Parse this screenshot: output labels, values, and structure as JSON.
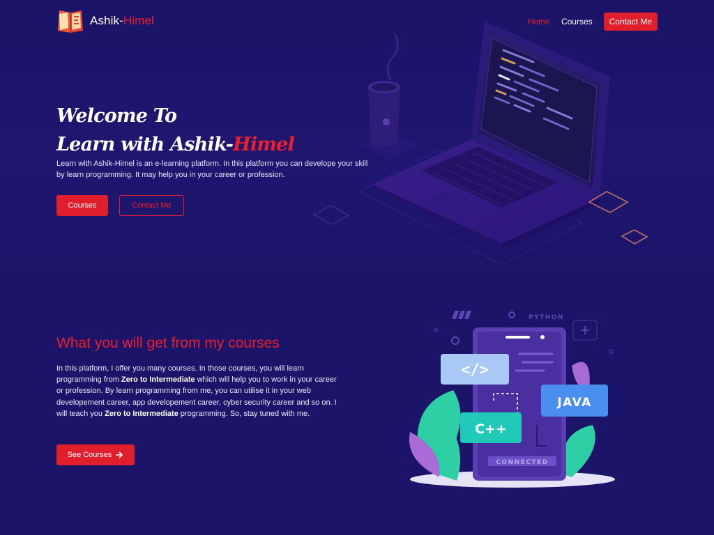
{
  "brand": {
    "name_part1": "Ashik-",
    "name_part2": "Himel"
  },
  "nav": {
    "items": [
      {
        "label": "Home",
        "active": true
      },
      {
        "label": "Courses",
        "active": false
      }
    ],
    "contact_label": "Contact Me"
  },
  "hero": {
    "title_line1": "Welcome To",
    "title_line2_part1": "Learn with Ashik-",
    "title_line2_part2": "Himel",
    "description": "Learn with Ashik-Himel is an e-learning platform. In this platform you can develope your skill by learn programming. It may help you in your career or profession.",
    "btn_courses": "Courses",
    "btn_contact": "Contact Me"
  },
  "features": {
    "title": "What you will get from my courses",
    "desc": [
      {
        "t": "In this platform, I offer you many courses. In those courses, you will learn programming from ",
        "b": false
      },
      {
        "t": "Zero to Intermediate",
        "b": true
      },
      {
        "t": " which will help you to work in your career or profession. By learn programming from me, you can utilise it in your web developement career, app developement career, cyber security career and so on. I will teach you ",
        "b": false
      },
      {
        "t": "Zero to Intermediate",
        "b": true
      },
      {
        "t": " programming. So, stay tuned with me.",
        "b": false
      }
    ],
    "btn_label": "See Courses"
  },
  "illustration": {
    "tags": {
      "python": "PYTHON",
      "code": "</>",
      "java": "JAVA",
      "cpp": "C++",
      "connected": "CONNECTED"
    }
  },
  "colors": {
    "accent": "#e11f2c",
    "bg": "#1c1469",
    "bg_hero": "#1f1670"
  },
  "icons": {
    "logo": "book-icon",
    "arrow": "arrow-right-icon"
  }
}
